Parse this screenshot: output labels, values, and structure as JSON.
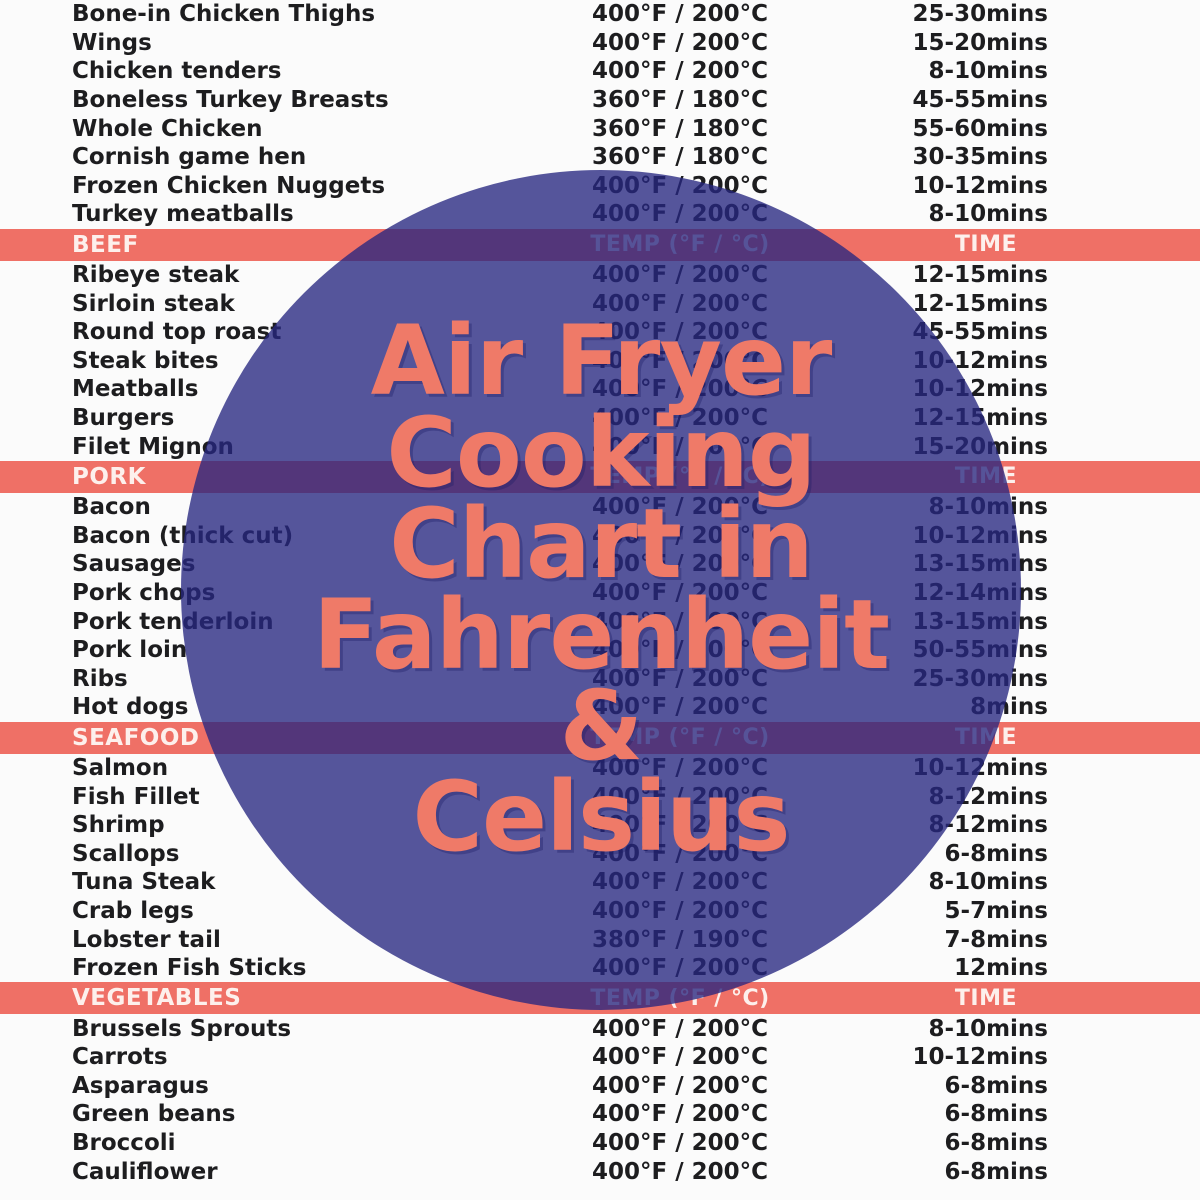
{
  "overlay": {
    "title_lines": [
      "Air Fryer",
      "Cooking",
      "Chart in",
      "Fahrenheit",
      "&",
      "Celsius"
    ],
    "circle_color": "#272680",
    "title_color": "#ef7a68"
  },
  "colors": {
    "accent_bar": "#ef7066",
    "bar_text": "#fdf0ec",
    "body_text": "#1d1d1f",
    "page_bg": "#fbfbfb"
  },
  "columns": {
    "name": "",
    "temp": "TEMP (°F / °C)",
    "time": "TIME"
  },
  "top_rows": [
    {
      "name": "Bone-in Chicken Thighs",
      "temp": "400°F / 200°C",
      "time": "25-30mins"
    },
    {
      "name": "Wings",
      "temp": "400°F / 200°C",
      "time": "15-20mins"
    },
    {
      "name": "Chicken tenders",
      "temp": "400°F / 200°C",
      "time": "8-10mins"
    },
    {
      "name": "Boneless Turkey Breasts",
      "temp": "360°F / 180°C",
      "time": "45-55mins"
    },
    {
      "name": "Whole Chicken",
      "temp": "360°F / 180°C",
      "time": "55-60mins"
    },
    {
      "name": "Cornish game hen",
      "temp": "360°F / 180°C",
      "time": "30-35mins"
    },
    {
      "name": "Frozen Chicken Nuggets",
      "temp": "400°F / 200°C",
      "time": "10-12mins"
    },
    {
      "name": "Turkey meatballs",
      "temp": "400°F / 200°C",
      "time": "8-10mins"
    }
  ],
  "sections": [
    {
      "label": "BEEF",
      "temp_header": "TEMP (°F / °C)",
      "time_header": "TIME",
      "rows": [
        {
          "name": "Ribeye steak",
          "temp": "400°F / 200°C",
          "time": "12-15mins"
        },
        {
          "name": "Sirloin steak",
          "temp": "400°F / 200°C",
          "time": "12-15mins"
        },
        {
          "name": "Round top roast",
          "temp": "400°F / 200°C",
          "time": "45-55mins"
        },
        {
          "name": "Steak bites",
          "temp": "400°F / 200°C",
          "time": "10-12mins"
        },
        {
          "name": "Meatballs",
          "temp": "400°F / 200°C",
          "time": "10-12mins"
        },
        {
          "name": "Burgers",
          "temp": "400°F / 200°C",
          "time": "12-15mins"
        },
        {
          "name": "Filet Mignon",
          "temp": "400°F / 200°C",
          "time": "15-20mins"
        }
      ]
    },
    {
      "label": "PORK",
      "temp_header": "TEMP (°F / °C)",
      "time_header": "TIME",
      "rows": [
        {
          "name": "Bacon",
          "temp": "400°F / 200°C",
          "time": "8-10mins"
        },
        {
          "name": "Bacon (thick cut)",
          "temp": "400°F / 200°C",
          "time": "10-12mins"
        },
        {
          "name": "Sausages",
          "temp": "400°F / 200°C",
          "time": "13-15mins"
        },
        {
          "name": "Pork chops",
          "temp": "400°F / 200°C",
          "time": "12-14mins"
        },
        {
          "name": "Pork tenderloin",
          "temp": "400°F / 200°C",
          "time": "13-15mins"
        },
        {
          "name": "Pork loin",
          "temp": "400°F / 200°C",
          "time": "50-55mins"
        },
        {
          "name": "Ribs",
          "temp": "400°F / 200°C",
          "time": "25-30mins"
        },
        {
          "name": "Hot dogs",
          "temp": "400°F / 200°C",
          "time": "8mins"
        }
      ]
    },
    {
      "label": "SEAFOOD",
      "temp_header": "TEMP (°F / °C)",
      "time_header": "TIME",
      "rows": [
        {
          "name": "Salmon",
          "temp": "400°F / 200°C",
          "time": "10-12mins"
        },
        {
          "name": "Fish Fillet",
          "temp": "400°F / 200°C",
          "time": "8-12mins"
        },
        {
          "name": "Shrimp",
          "temp": "400°F / 200°C",
          "time": "8-12mins"
        },
        {
          "name": "Scallops",
          "temp": "400°F / 200°C",
          "time": "6-8mins"
        },
        {
          "name": "Tuna Steak",
          "temp": "400°F / 200°C",
          "time": "8-10mins"
        },
        {
          "name": "Crab legs",
          "temp": "400°F / 200°C",
          "time": "5-7mins"
        },
        {
          "name": "Lobster tail",
          "temp": "380°F / 190°C",
          "time": "7-8mins"
        },
        {
          "name": "Frozen Fish Sticks",
          "temp": "400°F / 200°C",
          "time": "12mins"
        }
      ]
    },
    {
      "label": "VEGETABLES",
      "temp_header": "TEMP (°F / °C)",
      "time_header": "TIME",
      "rows": [
        {
          "name": "Brussels Sprouts",
          "temp": "400°F / 200°C",
          "time": "8-10mins"
        },
        {
          "name": "Carrots",
          "temp": "400°F / 200°C",
          "time": "10-12mins"
        },
        {
          "name": "Asparagus",
          "temp": "400°F / 200°C",
          "time": "6-8mins"
        },
        {
          "name": "Green beans",
          "temp": "400°F / 200°C",
          "time": "6-8mins"
        },
        {
          "name": "Broccoli",
          "temp": "400°F / 200°C",
          "time": "6-8mins"
        },
        {
          "name": "Cauliflower",
          "temp": "400°F / 200°C",
          "time": "6-8mins"
        }
      ]
    }
  ]
}
